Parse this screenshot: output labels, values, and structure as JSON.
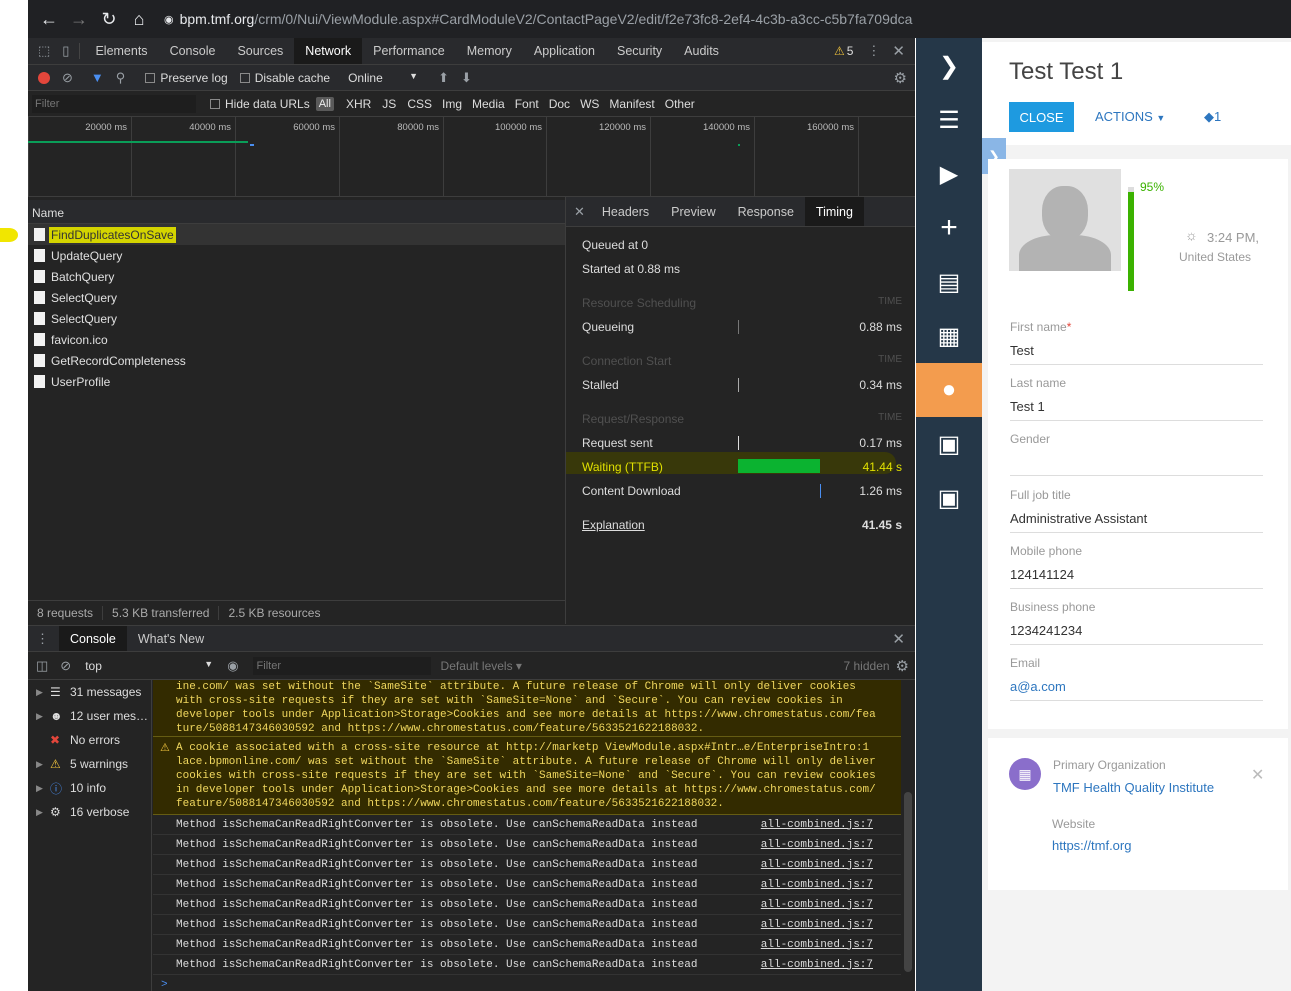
{
  "browser": {
    "url_host": "bpm.tmf.org",
    "url_path": "/crm/0/Nui/ViewModule.aspx#CardModuleV2/ContactPageV2/edit/f2e73fc8-2ef4-4c3b-a3cc-c5b7fa709dca"
  },
  "devtools": {
    "tabs": [
      "Elements",
      "Console",
      "Sources",
      "Network",
      "Performance",
      "Memory",
      "Application",
      "Security",
      "Audits"
    ],
    "selected_tab": "Network",
    "warning_count": "5",
    "toolbar": {
      "preserve_log": "Preserve log",
      "disable_cache": "Disable cache",
      "throttle": "Online"
    },
    "filter_placeholder": "Filter",
    "hide_data_urls": "Hide data URLs",
    "filter_types": [
      "All",
      "XHR",
      "JS",
      "CSS",
      "Img",
      "Media",
      "Font",
      "Doc",
      "WS",
      "Manifest",
      "Other"
    ],
    "timeline_ticks": [
      "20000 ms",
      "40000 ms",
      "60000 ms",
      "80000 ms",
      "100000 ms",
      "120000 ms",
      "140000 ms",
      "160000 ms"
    ],
    "name_header": "Name",
    "requests": [
      "FindDuplicatesOnSave",
      "UpdateQuery",
      "BatchQuery",
      "SelectQuery",
      "SelectQuery",
      "favicon.ico",
      "GetRecordCompleteness",
      "UserProfile"
    ],
    "status": {
      "requests": "8 requests",
      "transferred": "5.3 KB transferred",
      "resources": "2.5 KB resources"
    },
    "detail_tabs": [
      "Headers",
      "Preview",
      "Response",
      "Timing"
    ],
    "timing": {
      "queued": "Queued at 0",
      "started": "Started at 0.88 ms",
      "sec1": "Resource Scheduling",
      "sec2": "Connection Start",
      "sec3": "Request/Response",
      "time_label": "TIME",
      "queueing": "Queueing",
      "queueing_v": "0.88 ms",
      "stalled": "Stalled",
      "stalled_v": "0.34 ms",
      "sent": "Request sent",
      "sent_v": "0.17 ms",
      "waiting": "Waiting (TTFB)",
      "waiting_v": "41.44 s",
      "download": "Content Download",
      "download_v": "1.26 ms",
      "explanation": "Explanation",
      "total": "41.45 s"
    },
    "console": {
      "tabs": [
        "Console",
        "What's New"
      ],
      "context": "top",
      "filter_placeholder": "Filter",
      "levels": "Default levels",
      "hidden": "7 hidden",
      "sidebar": [
        "31 messages",
        "12 user mes…",
        "No errors",
        "5 warnings",
        "10 info",
        "16 verbose"
      ],
      "warn1": [
        "ine.com/ was set without the `SameSite` attribute. A future release of Chrome will only deliver cookies",
        "with cross-site requests if they are set with `SameSite=None` and `Secure`. You can review cookies in",
        "developer tools under Application>Storage>Cookies and see more details at https://www.chromestatus.com/fea",
        "ture/5088147346030592 and https://www.chromestatus.com/feature/5633521622188032."
      ],
      "warn2": [
        "A cookie associated with a cross-site resource at http://marketp ViewModule.aspx#Intr…e/EnterpriseIntro:1",
        "lace.bpmonline.com/ was set without the `SameSite` attribute. A future release of Chrome will only deliver",
        "cookies with cross-site requests if they are set with `SameSite=None` and `Secure`. You can review cookies",
        "in developer tools under Application>Storage>Cookies and see more details at https://www.chromestatus.com/",
        "feature/5088147346030592 and https://www.chromestatus.com/feature/5633521622188032."
      ],
      "line": "Method isSchemaCanReadRightConverter is obsolete. Use canSchemaReadData instead",
      "line_src": "all-combined.js:7",
      "line_count": 8,
      "prompt": ">"
    }
  },
  "app": {
    "title": "Test Test 1",
    "close": "CLOSE",
    "actions": "ACTIONS",
    "tag_count": "1",
    "completeness": "95%",
    "time": "3:24 PM,",
    "country": "United States",
    "fields": [
      {
        "label": "First name",
        "value": "Test",
        "required": "*"
      },
      {
        "label": "Last name",
        "value": "Test 1"
      },
      {
        "label": "Gender",
        "value": ""
      },
      {
        "label": "Full job title",
        "value": "Administrative Assistant"
      },
      {
        "label": "Mobile phone",
        "value": "124141124"
      },
      {
        "label": "Business phone",
        "value": "1234241234"
      },
      {
        "label": "Email",
        "value": "a@a.com"
      }
    ],
    "org_label": "Primary Organization",
    "org_value": "TMF Health Quality Institute",
    "website_label": "Website",
    "website_value": "https://tmf.org",
    "accent": "#f39c4e",
    "link": "#2d76bf"
  }
}
